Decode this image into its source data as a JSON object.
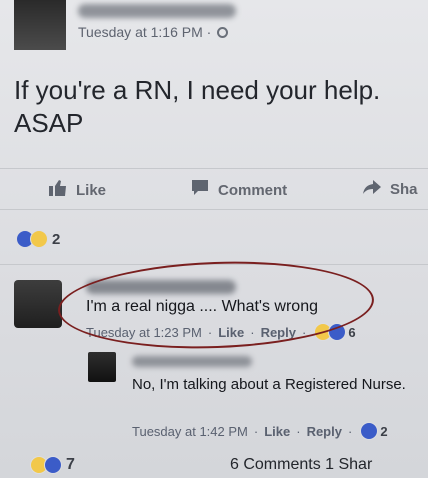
{
  "post": {
    "timestamp": "Tuesday at 1:16 PM ·",
    "text_line1": "If you're a RN, I need your help.",
    "text_line2": "ASAP",
    "actions": {
      "like": "Like",
      "comment": "Comment",
      "share": "Sha"
    },
    "reaction_count": "2",
    "reaction_icons": [
      "like-icon",
      "haha-icon"
    ]
  },
  "comments": [
    {
      "text": "I'm a real nigga .... What's wrong",
      "timestamp": "Tuesday at 1:23 PM",
      "like": "Like",
      "reply": "Reply",
      "reaction_count": "6",
      "reaction_icons": [
        "haha-icon",
        "like-icon"
      ]
    },
    {
      "text": "No, I'm talking about a Registered Nurse.",
      "timestamp": "Tuesday at 1:42 PM",
      "like": "Like",
      "reply": "Reply",
      "reaction_count": "2",
      "reaction_icons": [
        "like-icon"
      ]
    }
  ],
  "footer": {
    "reaction_count": "7",
    "stats": "6 Comments 1 Shar",
    "reaction_icons": [
      "haha-icon",
      "like-icon"
    ]
  },
  "colors": {
    "annotation_circle": "#7a1f1f",
    "like_blue": "#3b5cc8",
    "haha_yellow": "#f2c84a"
  }
}
